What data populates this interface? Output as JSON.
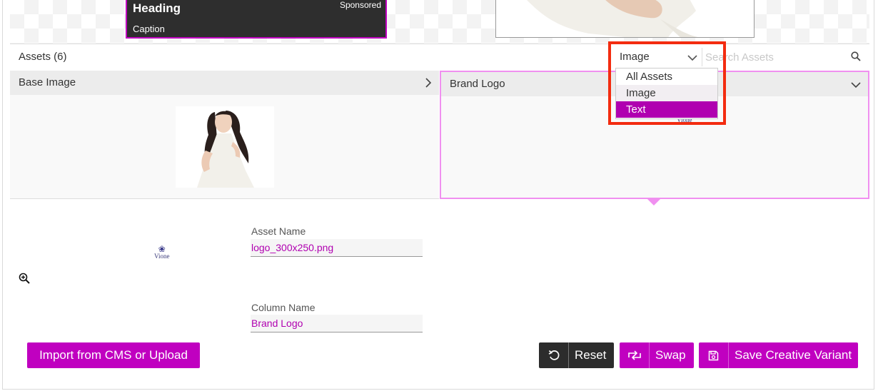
{
  "preview": {
    "ad_heading": "Heading",
    "ad_sponsored": "Sponsored",
    "ad_caption": "Caption"
  },
  "assets": {
    "title": "Assets (6)",
    "filter_value": "Image",
    "search_placeholder": "Search Assets",
    "dropdown_options": [
      "All Assets",
      "Image",
      "Text"
    ],
    "dropdown_selected": "Text"
  },
  "panels": {
    "left_title": "Base Image",
    "right_title": "Brand Logo",
    "logo_text": "Vione"
  },
  "detail": {
    "logo_text": "Vione",
    "asset_name_label": "Asset Name",
    "asset_name_value": "logo_300x250.png",
    "column_name_label": "Column Name",
    "column_name_value": "Brand Logo"
  },
  "buttons": {
    "import": "Import from CMS or Upload",
    "reset": "Reset",
    "swap": "Swap",
    "save": "Save Creative Variant"
  },
  "colors": {
    "accent": "#c000c0",
    "highlight": "#f32c10",
    "dark_button": "#2c2c2c"
  }
}
